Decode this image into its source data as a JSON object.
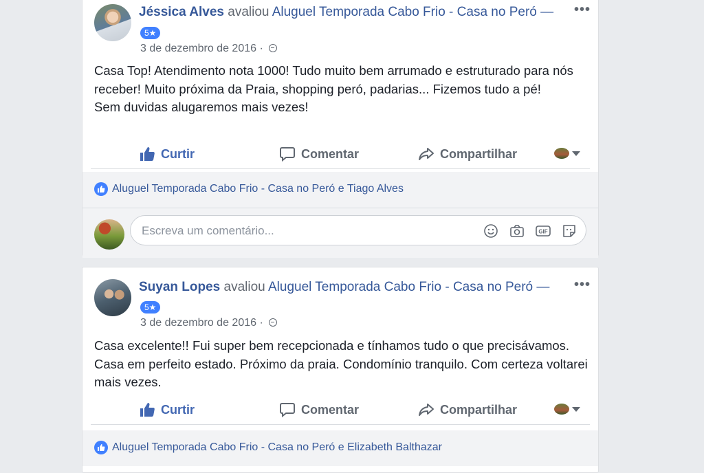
{
  "posts": [
    {
      "author": "Jéssica Alves",
      "verb": "avaliou",
      "page": "Aluguel Temporada Cabo Frio - Casa no Peró —",
      "rating": "5★",
      "date": "3 de dezembro de 2016 ·",
      "lines": [
        "Casa Top! Atendimento nota 1000! Tudo muito bem arrumado e estruturado para nós receber! Muito próxima da Praia, shopping peró, padarias... Fizemos tudo a pé!",
        "Sem duvidas alugaremos mais vezes!"
      ],
      "likes": "Aluguel Temporada Cabo Frio - Casa no Peró e Tiago Alves"
    },
    {
      "author": "Suyan Lopes",
      "verb": "avaliou",
      "page": "Aluguel Temporada Cabo Frio - Casa no Peró —",
      "rating": "5★",
      "date": "3 de dezembro de 2016 ·",
      "lines": [
        "Casa excelente!! Fui super bem recepcionada e tínhamos tudo o que precisávamos. Casa em perfeito estado. Próximo da praia. Condomínio tranquilo. Com certeza voltarei mais vezes."
      ],
      "likes": "Aluguel Temporada Cabo Frio - Casa no Peró e Elizabeth Balthazar"
    }
  ],
  "actions": {
    "like": "Curtir",
    "comment": "Comentar",
    "share": "Compartilhar"
  },
  "more": "•••",
  "comment_box": {
    "placeholder": "Escreva um comentário..."
  },
  "icons": {
    "like": "thumbs-up-icon",
    "comment": "speech-bubble-icon",
    "share": "share-arrow-icon",
    "privacy": "globe-icon",
    "emoji": "smiley-icon",
    "camera": "camera-icon",
    "gif": "gif-icon",
    "sticker": "sticker-icon"
  },
  "colors": {
    "link": "#365899",
    "accent": "#4267b2",
    "badge": "#4080ff"
  }
}
